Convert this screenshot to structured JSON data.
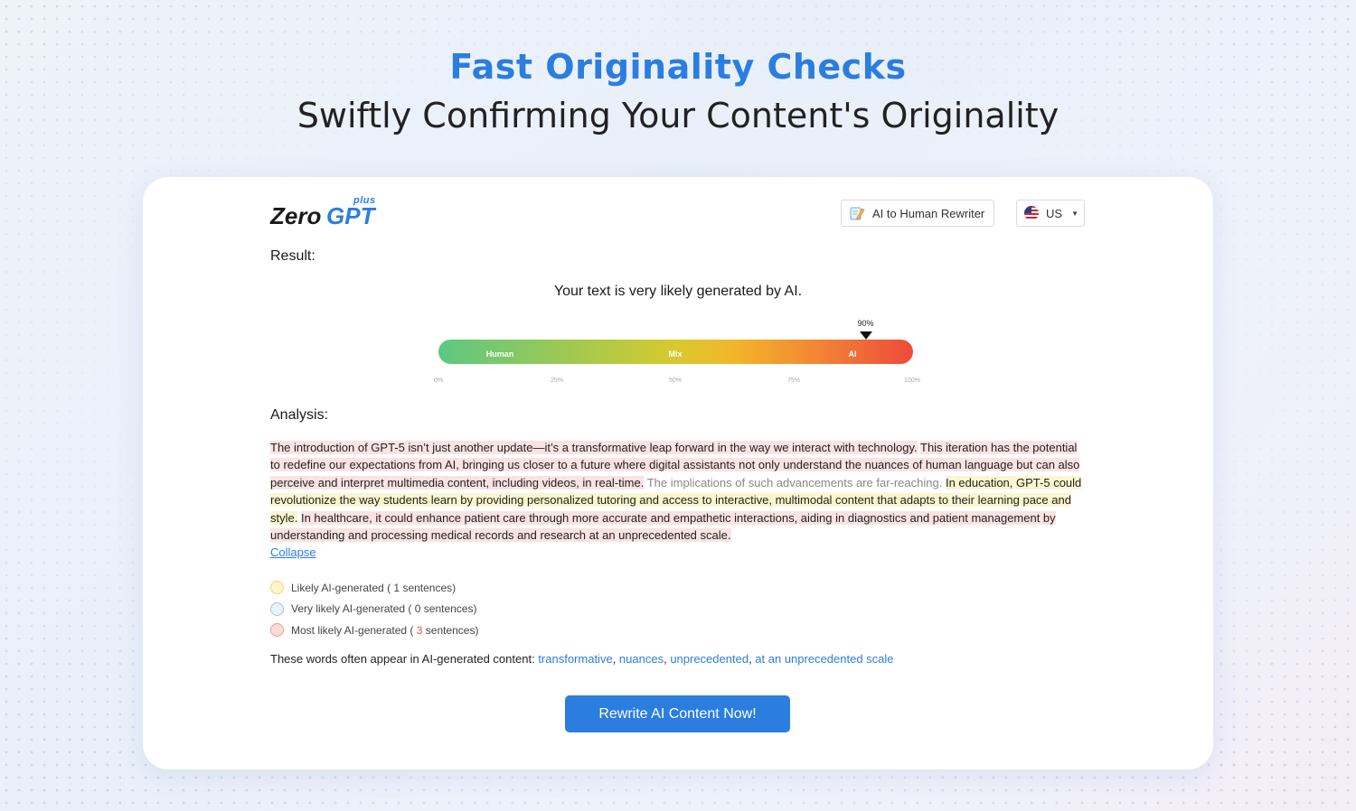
{
  "hero": {
    "title": "Fast Originality Checks",
    "subtitle": "Swiftly Confirming Your Content's Originality"
  },
  "header": {
    "logo_zero": "Zero",
    "logo_gpt": "GPT",
    "logo_plus": "plus",
    "rewriter_label": "AI to Human Rewriter",
    "lang_label": "US",
    "icons": {
      "rewriter": "pencil-note-icon",
      "lang": "us-flag-icon",
      "caret": "caret-down-icon"
    }
  },
  "result": {
    "label": "Result:",
    "verdict": "Your text is very likely generated by AI.",
    "score_label": "90%",
    "score": 0.9,
    "zones": [
      "Human",
      "Mix",
      "AI"
    ],
    "ticks": [
      "0%",
      "25%",
      "50%",
      "75%",
      "100%"
    ]
  },
  "analysis": {
    "label": "Analysis:",
    "s1": "The introduction of GPT-5 isn’t just another update—it’s a transformative leap forward in the way we interact with technology.",
    "s2": "This iteration has the potential to redefine our expectations from AI, bringing us closer to a future where digital assistants not only understand the nuances of human language but can also perceive and interpret multimedia content, including videos, in real-time.",
    "s3": "The implications of such advancements are far-reaching.",
    "s4": "In education, GPT-5 could revolutionize the way students learn by providing personalized tutoring and access to interactive, multimodal content that adapts to their learning pace and style.",
    "s5": "In healthcare, it could enhance patient care through more accurate and empathetic interactions, aiding in diagnostics and patient management by understanding and processing medical records and research at an unprecedented scale.",
    "collapse": "Collapse"
  },
  "legend": [
    {
      "prefix": "Likely AI-generated (",
      "count": "1",
      "suffix": " sentences)",
      "color": "#fdf5c9"
    },
    {
      "prefix": "Very likely AI-generated (",
      "count": "0",
      "suffix": " sentences)",
      "color": "#eaf2fc"
    },
    {
      "prefix": "Most likely AI-generated (",
      "count": "3",
      "suffix": " sentences)",
      "color": "#fbdcd8"
    }
  ],
  "words": {
    "intro": "These words often appear in AI-generated content: ",
    "items": [
      "transformative",
      "nuances",
      "unprecedented",
      "at an unprecedented scale"
    ]
  },
  "cta": {
    "label": "Rewrite AI Content Now!"
  },
  "colors": {
    "accent": "#2b7de0",
    "ai_red": "#ee4a3a",
    "human_green": "#5cc883"
  }
}
